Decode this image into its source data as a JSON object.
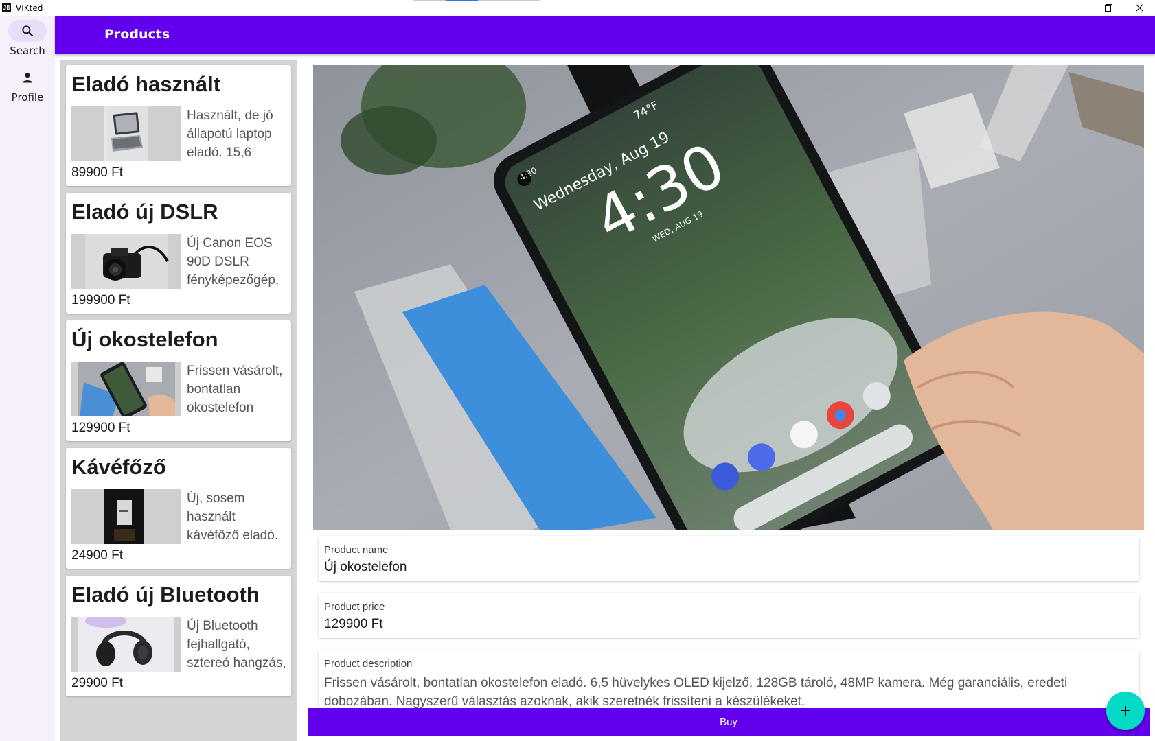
{
  "window": {
    "title": "VIKted",
    "icon_text": "JB",
    "controls": [
      "minimize-icon",
      "restore-icon",
      "close-icon"
    ]
  },
  "nav": {
    "items": [
      {
        "label": "Search",
        "icon": "search-icon",
        "active": true
      },
      {
        "label": "Profile",
        "icon": "person-icon",
        "active": false
      }
    ]
  },
  "appbar": {
    "title": "Products"
  },
  "products": [
    {
      "title": "Eladó használt",
      "description": "Használt, de jó állapotú laptop eladó. 15,6",
      "price": "89900 Ft",
      "thumb": "laptop"
    },
    {
      "title": "Eladó új DSLR",
      "description": "Új Canon EOS 90D DSLR fényképezőgép,",
      "price": "199900 Ft",
      "thumb": "camera"
    },
    {
      "title": "Új okostelefon",
      "description": "Frissen vásárolt, bontatlan okostelefon",
      "price": "129900 Ft",
      "thumb": "phone"
    },
    {
      "title": "Kávéfőző",
      "description": "Új, sosem használt kávéfőző eladó.",
      "price": "24900 Ft",
      "thumb": "coffee-maker"
    },
    {
      "title": "Eladó új Bluetooth",
      "description": "Új Bluetooth fejhallgató, sztereó hangzás,",
      "price": "29900 Ft",
      "thumb": "headphones"
    }
  ],
  "detail": {
    "image": "smartphone-photo",
    "name_label": "Product name",
    "name_value": "Új okostelefon",
    "price_label": "Product price",
    "price_value": "129900 Ft",
    "description_label": "Product description",
    "description_value": "Frissen vásárolt, bontatlan okostelefon eladó. 6,5 hüvelykes OLED kijelző, 128GB tároló, 48MP kamera. Még garanciális, eredeti dobozában. Nagyszerű választás azoknak, akik szeretnék frissíteni a készülékeket.",
    "phone_screen": {
      "time": "4:30",
      "date": "Wednesday, Aug 19",
      "date_small": "WED, AUG 19",
      "status_time": "4:30",
      "temp": "74°F"
    }
  },
  "buy_button": {
    "label": "Buy"
  },
  "fab": {
    "label": "+",
    "icon": "add-icon"
  },
  "colors": {
    "primary": "#6200ee",
    "secondary": "#03dac6",
    "nav_background": "#f6f0fb",
    "nav_active": "#e7def8",
    "list_background": "#d4d4d4"
  }
}
